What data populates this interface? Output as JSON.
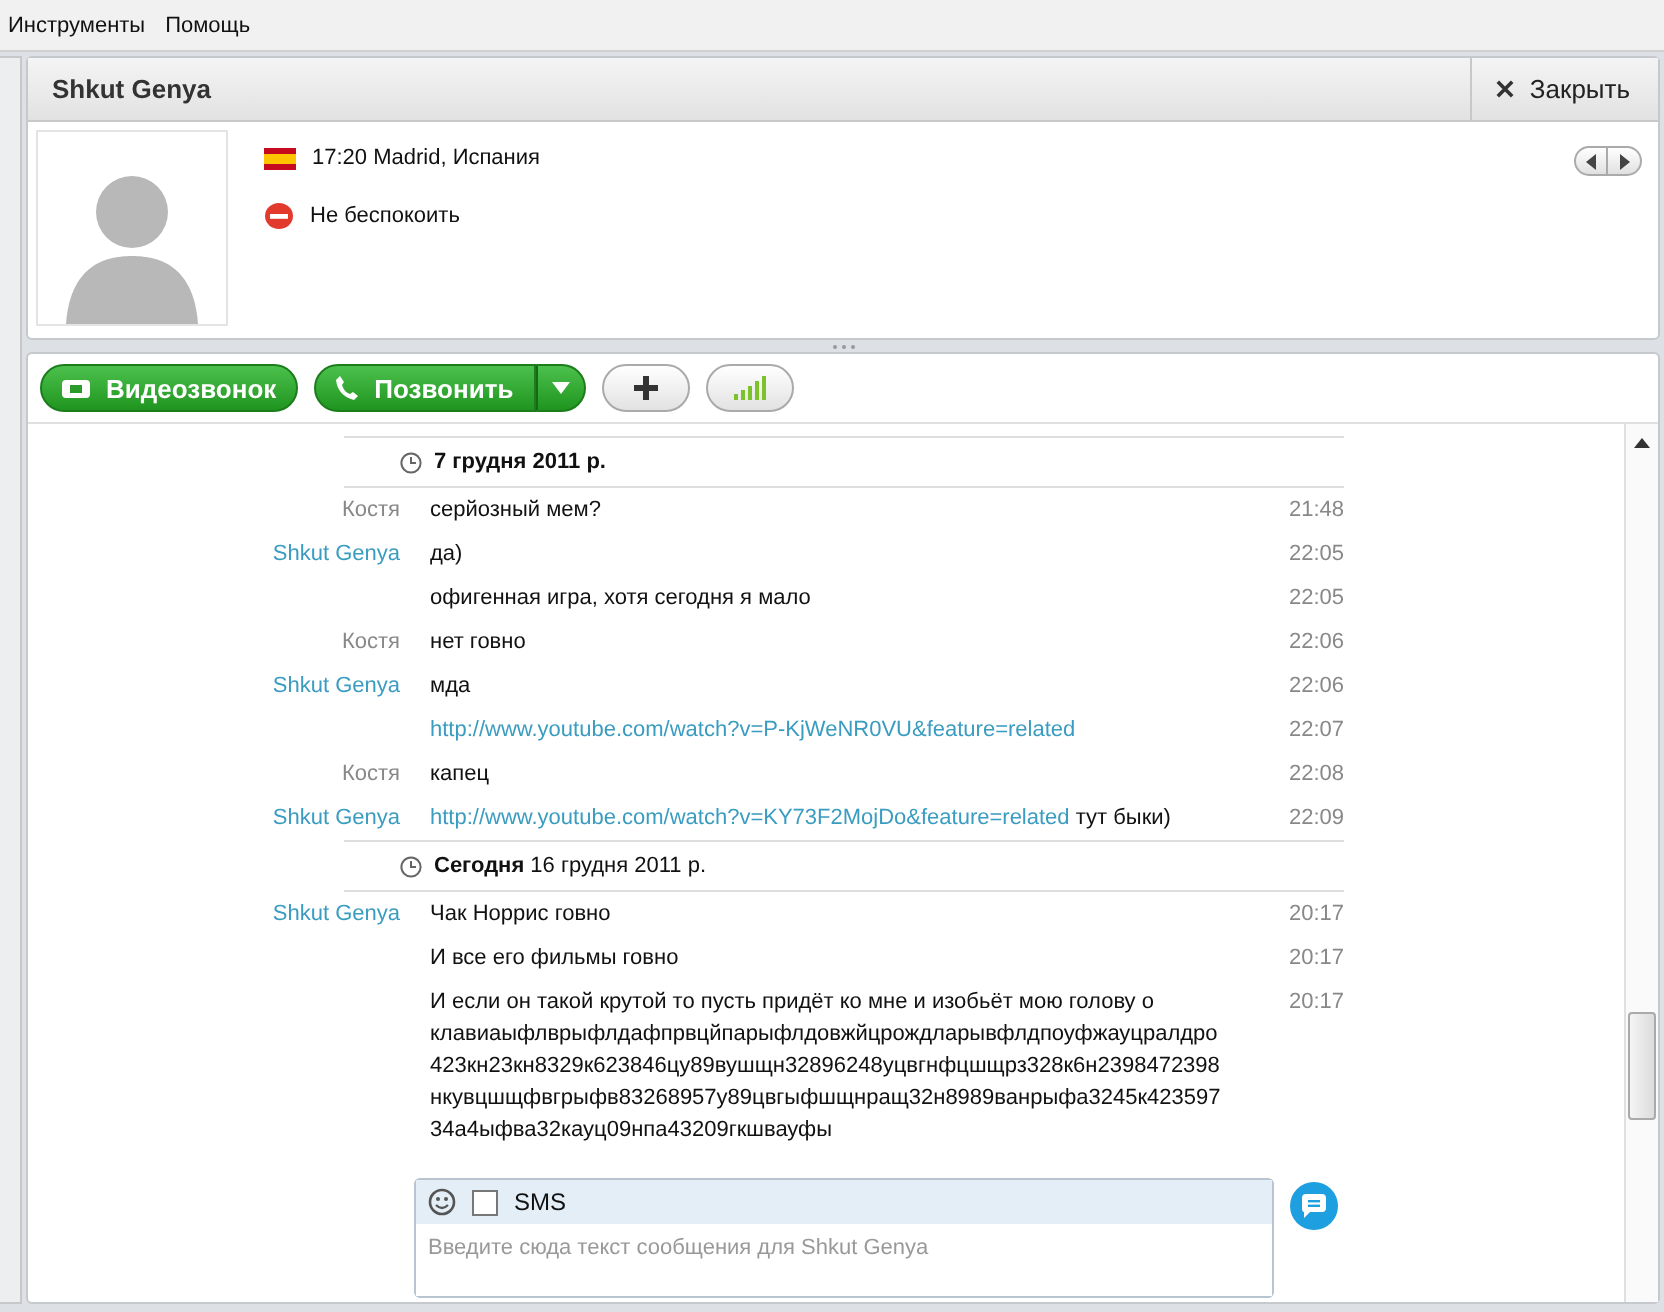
{
  "menu": [
    {
      "label": "Инструменты"
    },
    {
      "label": "Помощь"
    }
  ],
  "contact": {
    "name": "Shkut Genya",
    "close_label": "Закрыть",
    "local_time": "17:20 Madrid, Испания",
    "status": "Не беспокоить"
  },
  "toolbar": {
    "video_call": "Видеозвонок",
    "call": "Позвонить"
  },
  "days": [
    {
      "date": "7 грудня 2011 р.",
      "messages": [
        {
          "author": "Костя",
          "kind": "remote",
          "text": "серйозный мем?",
          "time": "21:48"
        },
        {
          "author": "Shkut Genya",
          "kind": "local",
          "text": "да)",
          "time": "22:05"
        },
        {
          "kind": "local",
          "text": "офигенная игра, хотя сегодня я мало",
          "time": "22:05"
        },
        {
          "author": "Костя",
          "kind": "remote",
          "text": "нет говно",
          "time": "22:06"
        },
        {
          "author": "Shkut Genya",
          "kind": "local",
          "text": "мда",
          "time": "22:06"
        },
        {
          "kind": "local",
          "link": "http://www.youtube.com/watch?v=P-KjWeNR0VU&feature=related",
          "time": "22:07"
        },
        {
          "author": "Костя",
          "kind": "remote",
          "text": "капец",
          "time": "22:08"
        },
        {
          "author": "Shkut Genya",
          "kind": "local",
          "link": "http://www.youtube.com/watch?v=KY73F2MojDo&feature=related",
          "text": "тут быки)",
          "time": "22:09"
        }
      ]
    },
    {
      "date": "**Сегодня** 16 грудня 2011 р.",
      "messages": [
        {
          "author": "Shkut Genya",
          "kind": "local",
          "text": "Чак Норрис говно",
          "time": "20:17"
        },
        {
          "kind": "local",
          "text": "И все его фильмы говно",
          "time": "20:17"
        },
        {
          "kind": "local",
          "text": "И если он такой крутой то пусть придёт ко мне и изобьёт мою голову о клавиаыфлврыфлдафпрвцйпарыфлдовжйцрождларывфлдпоуфжауцралдро423кн23кн8329к623846цу89вушщн32896248уцвгнфцшщрз328к6н2398472398нкувцшщфвгрыфв83268957у89цвгыфшщнращ32н8989ванрыфа3245к42359734а4ыфва32кауц09нпа43209гкшвауфы",
          "time": "20:17"
        }
      ]
    }
  ],
  "composer": {
    "sms_label": "SMS",
    "sms_checked": false,
    "placeholder": "Введите сюда текст сообщения для Shkut Genya"
  }
}
